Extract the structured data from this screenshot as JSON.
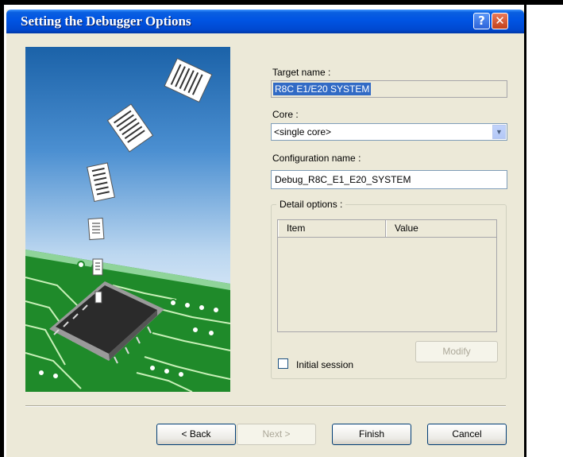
{
  "window": {
    "title": "Setting the Debugger Options"
  },
  "titlebar_buttons": {
    "help": "?",
    "close": "✕"
  },
  "form": {
    "target_name_label": "Target name :",
    "target_name_value": "R8C E1/E20 SYSTEM",
    "core_label": "Core :",
    "core_value": "<single core>",
    "config_name_label": "Configuration name :",
    "config_name_value": "Debug_R8C_E1_E20_SYSTEM"
  },
  "detail_options": {
    "legend": "Detail options :",
    "columns": [
      "Item",
      "Value"
    ],
    "rows": [],
    "modify_label": "Modify",
    "initial_session_label": "Initial session",
    "initial_session_checked": false
  },
  "footer": {
    "back_label": "< Back",
    "next_label": "Next >",
    "finish_label": "Finish",
    "cancel_label": "Cancel"
  },
  "colors": {
    "titlebar": "#0054e3",
    "selection": "#316ac5",
    "dialog_bg": "#ece9d8",
    "pcb_green": "#1f8a2a"
  },
  "illustration": {
    "subject": "documents-flying-onto-chip-on-circuit-board"
  }
}
